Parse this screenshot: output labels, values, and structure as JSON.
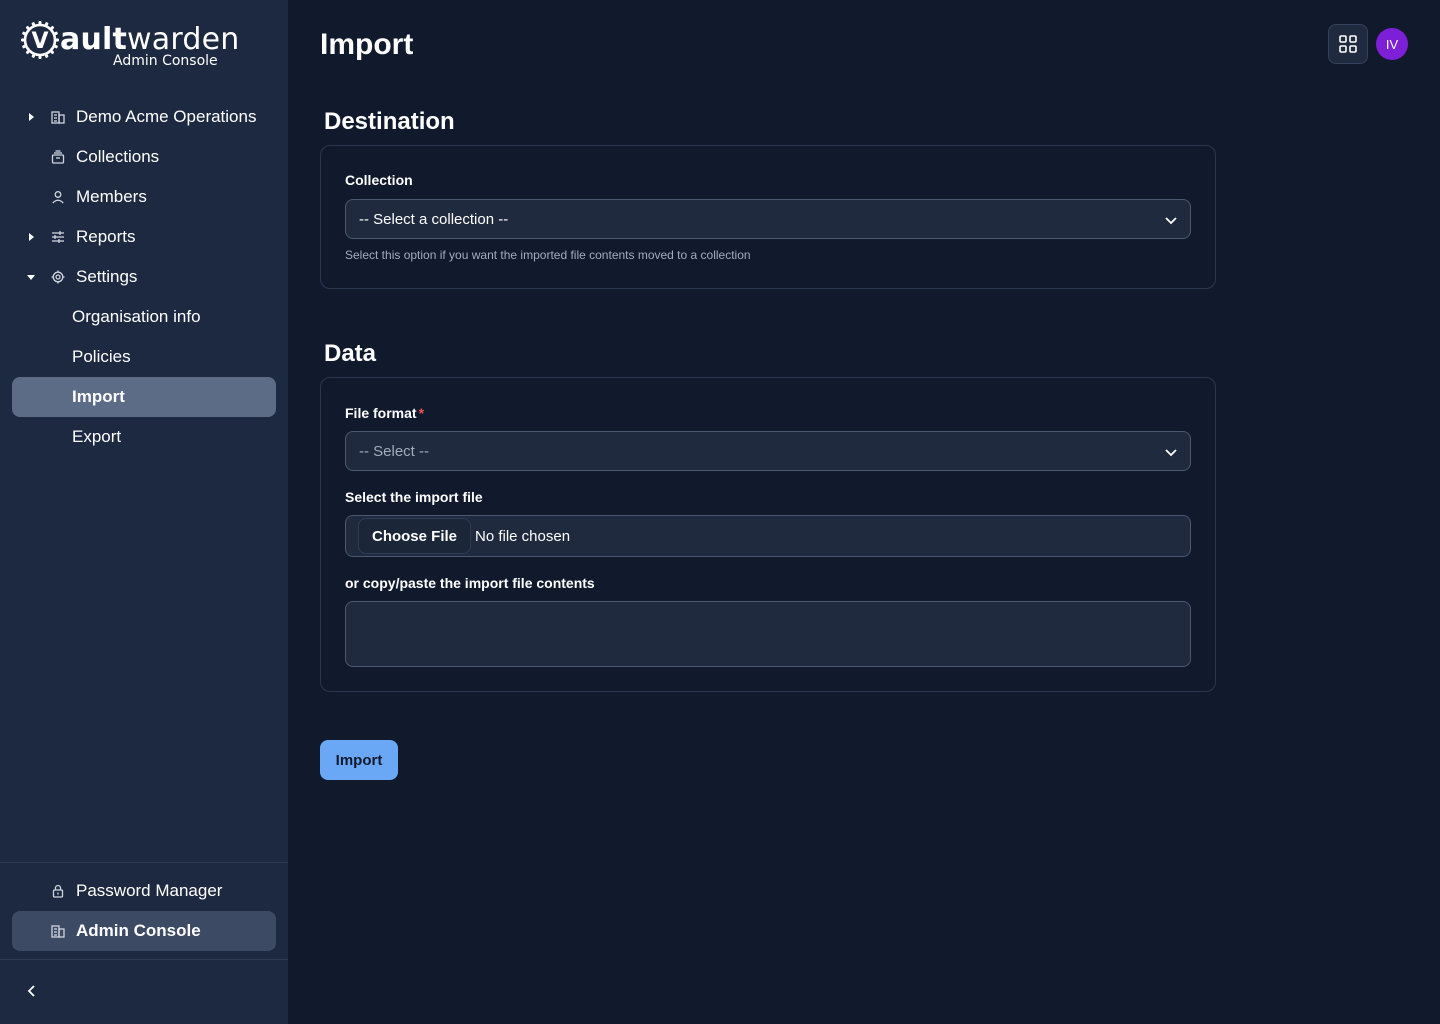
{
  "brand": {
    "logo_letter": "V",
    "name_prefix": "ault",
    "name_suffix": "warden",
    "subtitle": "Admin Console"
  },
  "sidebar": {
    "items": [
      {
        "label": "Demo Acme Operations",
        "icon": "building-icon",
        "caret": "right"
      },
      {
        "label": "Collections",
        "icon": "collection-icon"
      },
      {
        "label": "Members",
        "icon": "user-icon"
      },
      {
        "label": "Reports",
        "icon": "sliders-icon",
        "caret": "right"
      },
      {
        "label": "Settings",
        "icon": "gear-icon",
        "caret": "down"
      }
    ],
    "settings_children": [
      {
        "label": "Organisation info"
      },
      {
        "label": "Policies"
      },
      {
        "label": "Import",
        "active": true
      },
      {
        "label": "Export"
      }
    ],
    "footer_items": [
      {
        "label": "Password Manager",
        "icon": "lock-icon"
      },
      {
        "label": "Admin Console",
        "icon": "building-icon",
        "active": true
      }
    ],
    "collapse_icon": "chevron-left-icon"
  },
  "header": {
    "title": "Import",
    "apps_icon": "grid-icon",
    "avatar_initials": "IV",
    "avatar_color": "#7e1fd8"
  },
  "destination": {
    "heading": "Destination",
    "collection_label": "Collection",
    "collection_value": "-- Select a collection --",
    "collection_hint": "Select this option if you want the imported file contents moved to a collection"
  },
  "data_section": {
    "heading": "Data",
    "file_format_label": "File format",
    "required_marker": "*",
    "file_format_value": "-- Select --",
    "file_label": "Select the import file",
    "file_button": "Choose File",
    "file_status": "No file chosen",
    "paste_label": "or copy/paste the import file contents"
  },
  "actions": {
    "import_button": "Import"
  },
  "colors": {
    "background": "#111a2d",
    "sidebar": "#1c2940",
    "primary_button": "#6aa8f5",
    "required": "#f05252"
  }
}
